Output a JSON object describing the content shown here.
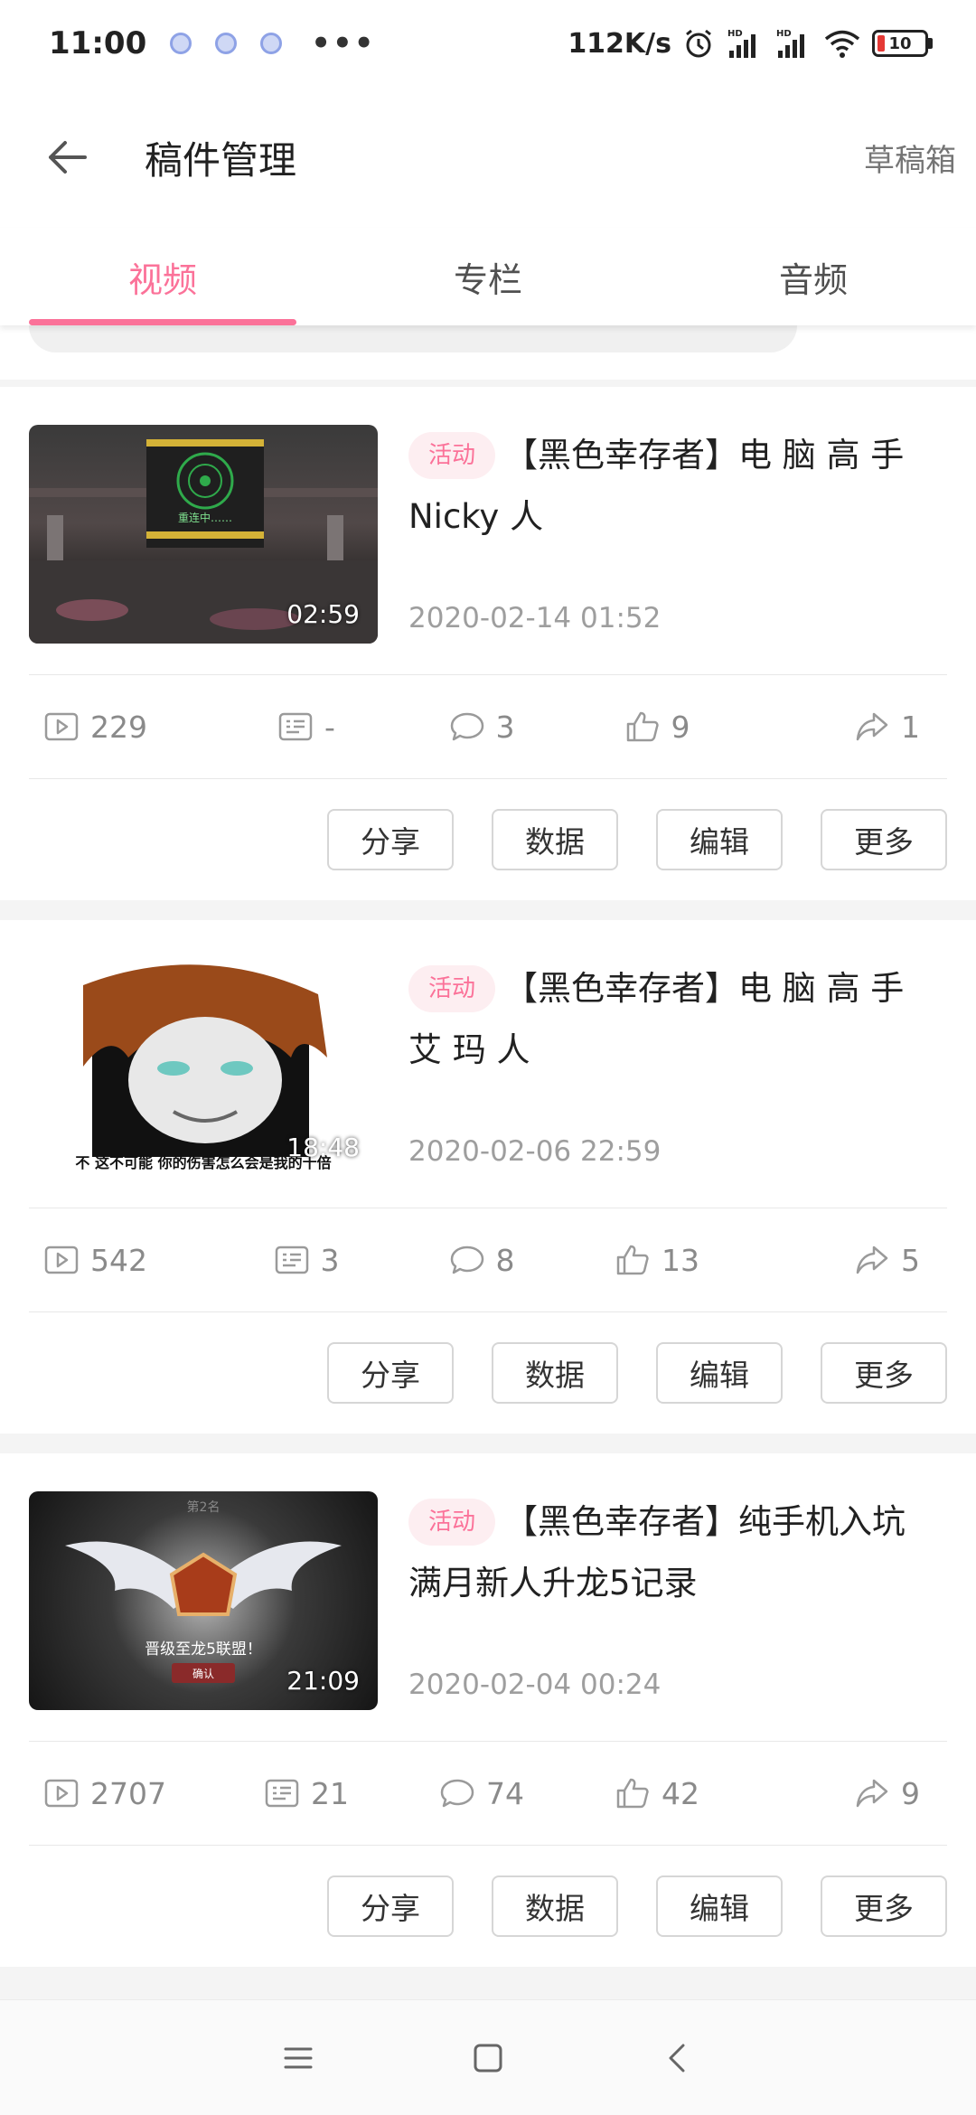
{
  "status_bar": {
    "time": "11:00",
    "more": "•••",
    "net_speed": "112K/s",
    "battery": "10",
    "icons": [
      "notification-icon",
      "alarm-icon",
      "signal-icon",
      "wifi-icon",
      "battery-icon"
    ]
  },
  "app_bar": {
    "title": "稿件管理",
    "drafts_label": "草稿箱"
  },
  "tabs": [
    {
      "label": "视频",
      "active": true
    },
    {
      "label": "专栏",
      "active": false
    },
    {
      "label": "音频",
      "active": false
    }
  ],
  "accent_color": "#fb7299",
  "videos": [
    {
      "tag": "活动",
      "title_line1": "【黑色幸存者】电 脑 高 手",
      "title_line2": "Nicky 人",
      "date": "2020-02-14 01:52",
      "duration": "02:59",
      "thumb_caption": "重连中……",
      "stats": {
        "plays": "229",
        "danmaku": "-",
        "comments": "3",
        "likes": "9",
        "shares": "1"
      }
    },
    {
      "tag": "活动",
      "title_line1": "【黑色幸存者】电 脑 高 手",
      "title_line2": "艾 玛 人",
      "date": "2020-02-06 22:59",
      "duration": "18:48",
      "thumb_caption": "不 这不可能 你的伤害怎么会是我的十倍",
      "stats": {
        "plays": "542",
        "danmaku": "3",
        "comments": "8",
        "likes": "13",
        "shares": "5"
      }
    },
    {
      "tag": "活动",
      "title_line1": "【黑色幸存者】纯手机入坑",
      "title_line2": "满月新人升龙5记录",
      "date": "2020-02-04 00:24",
      "duration": "21:09",
      "thumb_caption": "晋级至龙5联盟！",
      "thumb_top": "第2名",
      "thumb_button": "确认",
      "stats": {
        "plays": "2707",
        "danmaku": "21",
        "comments": "74",
        "likes": "42",
        "shares": "9"
      }
    }
  ],
  "actions": {
    "share": "分享",
    "data": "数据",
    "edit": "编辑",
    "more": "更多"
  }
}
